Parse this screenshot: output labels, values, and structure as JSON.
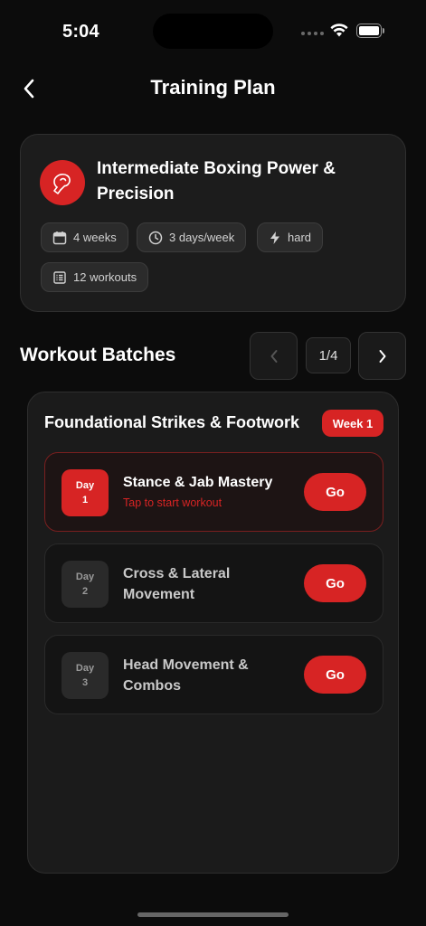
{
  "status_bar": {
    "time": "5:04"
  },
  "header": {
    "title": "Training Plan"
  },
  "plan": {
    "title": "Intermediate Boxing Power & Precision",
    "chips": {
      "duration": "4 weeks",
      "frequency": "3 days/week",
      "difficulty": "hard",
      "workouts": "12 workouts"
    }
  },
  "batches": {
    "section_title": "Workout Batches",
    "pager": "1/4",
    "current": {
      "title": "Foundational Strikes & Footwork",
      "week_label": "Week 1",
      "days": [
        {
          "day_label": "Day",
          "day_number": "1",
          "title": "Stance & Jab Mastery",
          "subtitle": "Tap to start workout",
          "go_label": "Go"
        },
        {
          "day_label": "Day",
          "day_number": "2",
          "title": "Cross & Lateral Movement",
          "go_label": "Go"
        },
        {
          "day_label": "Day",
          "day_number": "3",
          "title": "Head Movement & Combos",
          "go_label": "Go"
        }
      ]
    }
  },
  "colors": {
    "accent": "#d72424",
    "background": "#0c0c0c",
    "card": "#1c1c1c"
  },
  "icons": {
    "back": "chevron-left-icon",
    "plan": "boxing-glove-icon",
    "duration": "calendar-icon",
    "frequency": "clock-icon",
    "difficulty": "lightning-icon",
    "workouts": "list-icon"
  }
}
